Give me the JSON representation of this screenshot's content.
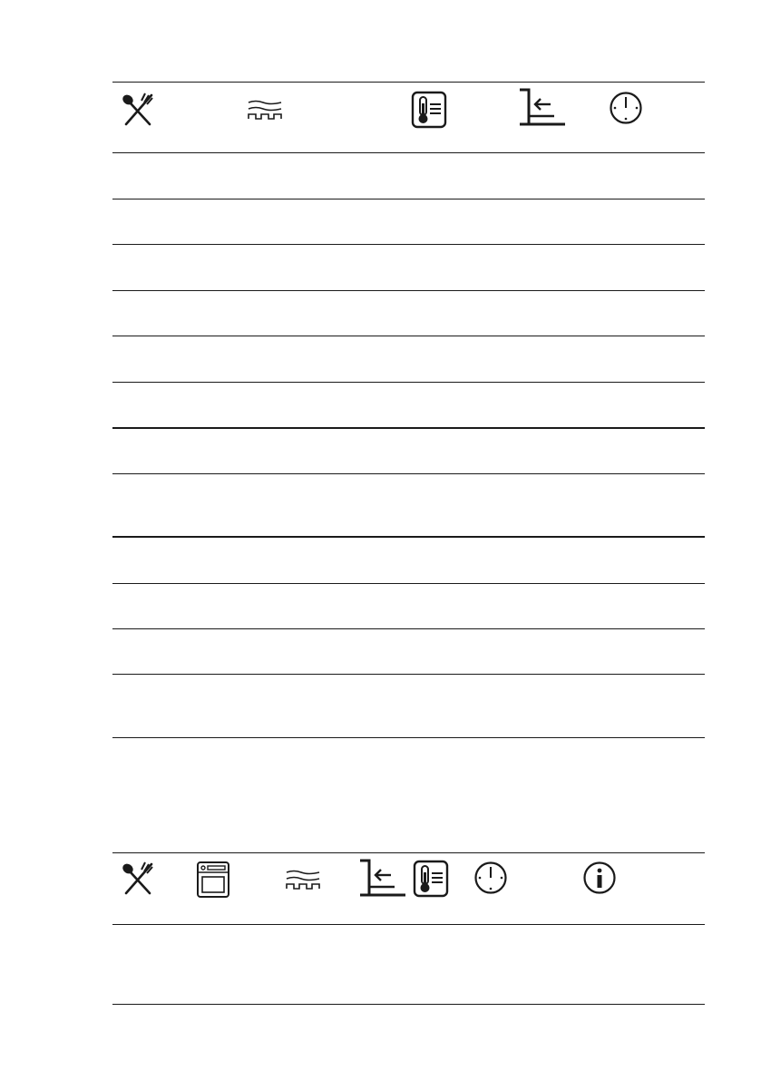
{
  "table1": {
    "header_icons": [
      "utensils-icon",
      "grill-heating-icon",
      "food-sensor-thermometer-icon",
      "shelf-position-icon",
      "clock-icon"
    ],
    "row_count": 12
  },
  "table2": {
    "header_icons": [
      "utensils-icon",
      "oven-icon",
      "grill-heating-icon",
      "shelf-position-icon",
      "food-sensor-thermometer-icon",
      "clock-icon",
      "info-icon"
    ],
    "row_count": 1
  }
}
